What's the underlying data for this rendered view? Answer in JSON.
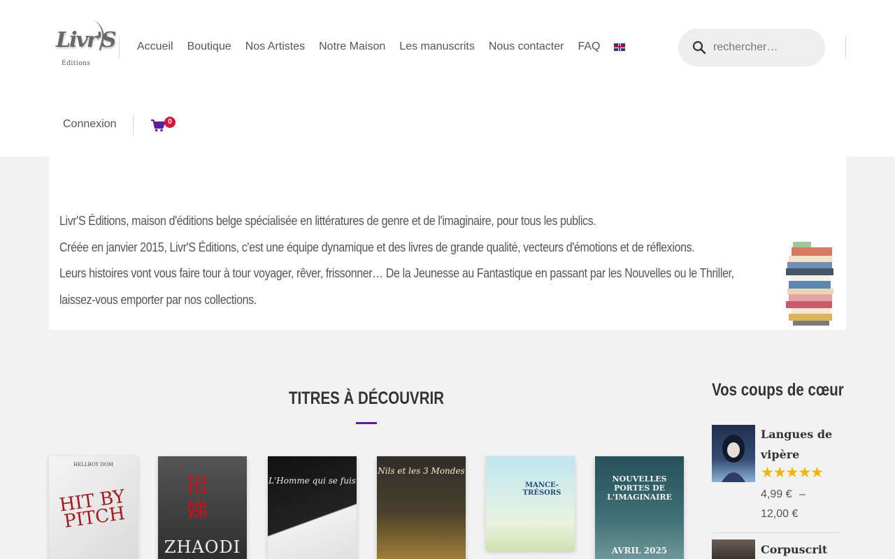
{
  "header": {
    "logo_text": "Livr'S",
    "logo_sub": "Éditions",
    "nav": [
      "Accueil",
      "Boutique",
      "Nos Artistes",
      "Notre Maison",
      "Les manuscrits",
      "Nous contacter",
      "FAQ"
    ],
    "language_icon": "uk-flag-icon",
    "search_placeholder": "rechercher…",
    "login_label": "Connexion",
    "cart_count": "0"
  },
  "intro": {
    "lines": [
      "Livr'S Éditions, maison d'éditions belge spécialisée en littératures de genre et de l'imaginaire, pour tous les publics.",
      "Créée en janvier 2015, Livr'S Éditions, c'est une équipe dynamique et des livres de grande qualité, vecteurs d'émotions et de réflexions.",
      "Leurs histoires vont vous faire tour à tour voyager, rêver, frissonner… De la Jeunesse au Fantastique en passant par les Nouvelles ou le Thriller,",
      "laissez-vous emporter par nos collections."
    ]
  },
  "section": {
    "title": "TITRES À DÉCOUVRIR"
  },
  "products": [
    {
      "cover_author": "HELLBOY DOM",
      "cover_title": "HIT BY PITCH"
    },
    {
      "cover_title": "ZHAODI",
      "cover_glyphs": "招娣"
    },
    {
      "cover_title": "L'Homme qui se fuis"
    },
    {
      "cover_title": "Nils et les 3 Mondes"
    },
    {
      "cover_title": "MANCE-TRÉSORS"
    },
    {
      "cover_title": "NOUVELLES PORTES DE L'IMAGINAIRE",
      "cover_sub": "AVRIL 2025"
    }
  ],
  "sidebar": {
    "title": "Vos coups de cœur",
    "items": [
      {
        "title": "Langues de vipère",
        "rating": "★★★★★",
        "rating_value": 5,
        "price_from": "4,99 €",
        "price_sep": "–",
        "price_to": "12,00 €"
      },
      {
        "title": "Corpuscrit"
      }
    ]
  },
  "colors": {
    "accent": "#5b1f9e",
    "cart_icon": "#5b1f9e",
    "badge": "#d6173a",
    "stars": "#f0b400"
  }
}
